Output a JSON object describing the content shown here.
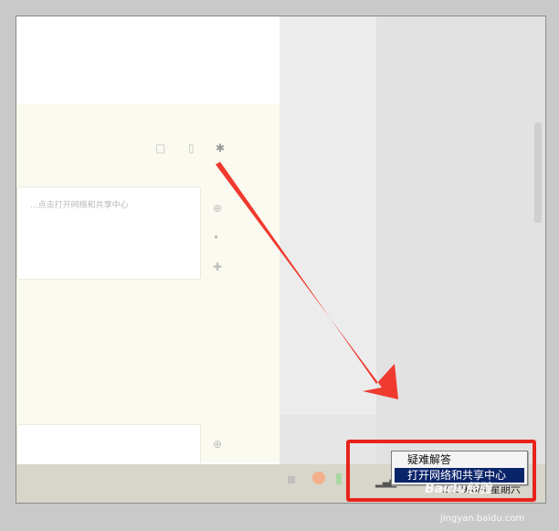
{
  "gray_column": {
    "text": ""
  },
  "textbox": {
    "snippet": "...点击打开网络和共享中心"
  },
  "context_menu": {
    "items": [
      {
        "label": "疑难解答",
        "highlighted": false
      },
      {
        "label": "打开网络和共享中心",
        "highlighted": true
      }
    ]
  },
  "taskbar": {
    "clock": "2019/8/4 星期六"
  },
  "watermark": {
    "logo": "Baidu经验",
    "site": "jingyan.baidu.com"
  },
  "colors": {
    "highlight_red": "#e8231b",
    "menu_selected_bg": "#0a246a",
    "taskbar_bg": "#d8d5cb",
    "page_beige": "#fbfaf0"
  },
  "icons": [
    "toolbar-icon",
    "plus-icon",
    "network-icon",
    "flag-icon",
    "arrow-annotation"
  ]
}
